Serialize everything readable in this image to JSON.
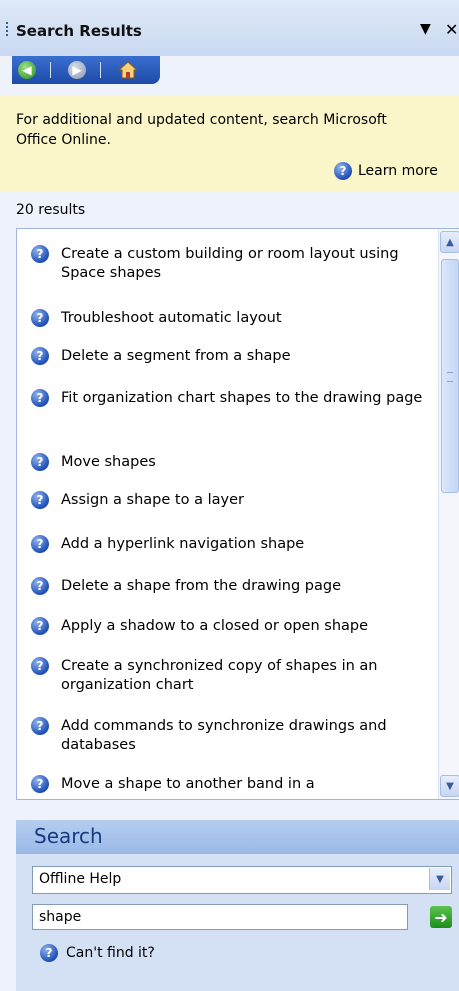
{
  "title_bar": {
    "title": "Search Results",
    "menu_glyph": "▼",
    "close_glyph": "✕"
  },
  "nav": {
    "back_icon": "back-icon",
    "forward_icon": "forward-icon",
    "home_icon": "home-icon"
  },
  "info": {
    "text": "For additional and updated content, search Microsoft Office Online.",
    "learn_more": "Learn more"
  },
  "results": {
    "count_text": "20 results",
    "items": [
      "Create a custom building or room layout using Space shapes",
      "Troubleshoot automatic layout",
      "Delete a segment from a shape",
      "Fit organization chart shapes to  the drawing page",
      "Move shapes",
      "Assign a shape to a layer",
      "Add a hyperlink navigation shape",
      "Delete a shape from the drawing page",
      "Apply a shadow to a closed or open shape",
      "Create a synchronized copy of shapes in an organization chart",
      "Add commands to synchronize drawings and databases",
      "Move a shape to another band in a"
    ]
  },
  "search": {
    "heading": "Search",
    "scope_value": "Offline Help",
    "query_value": "shape",
    "cant_find": "Can't find it?"
  },
  "colors": {
    "accent": "#1e4aa8",
    "info_bg": "#fbf6c9",
    "panel_bg": "#d4e1f5"
  }
}
